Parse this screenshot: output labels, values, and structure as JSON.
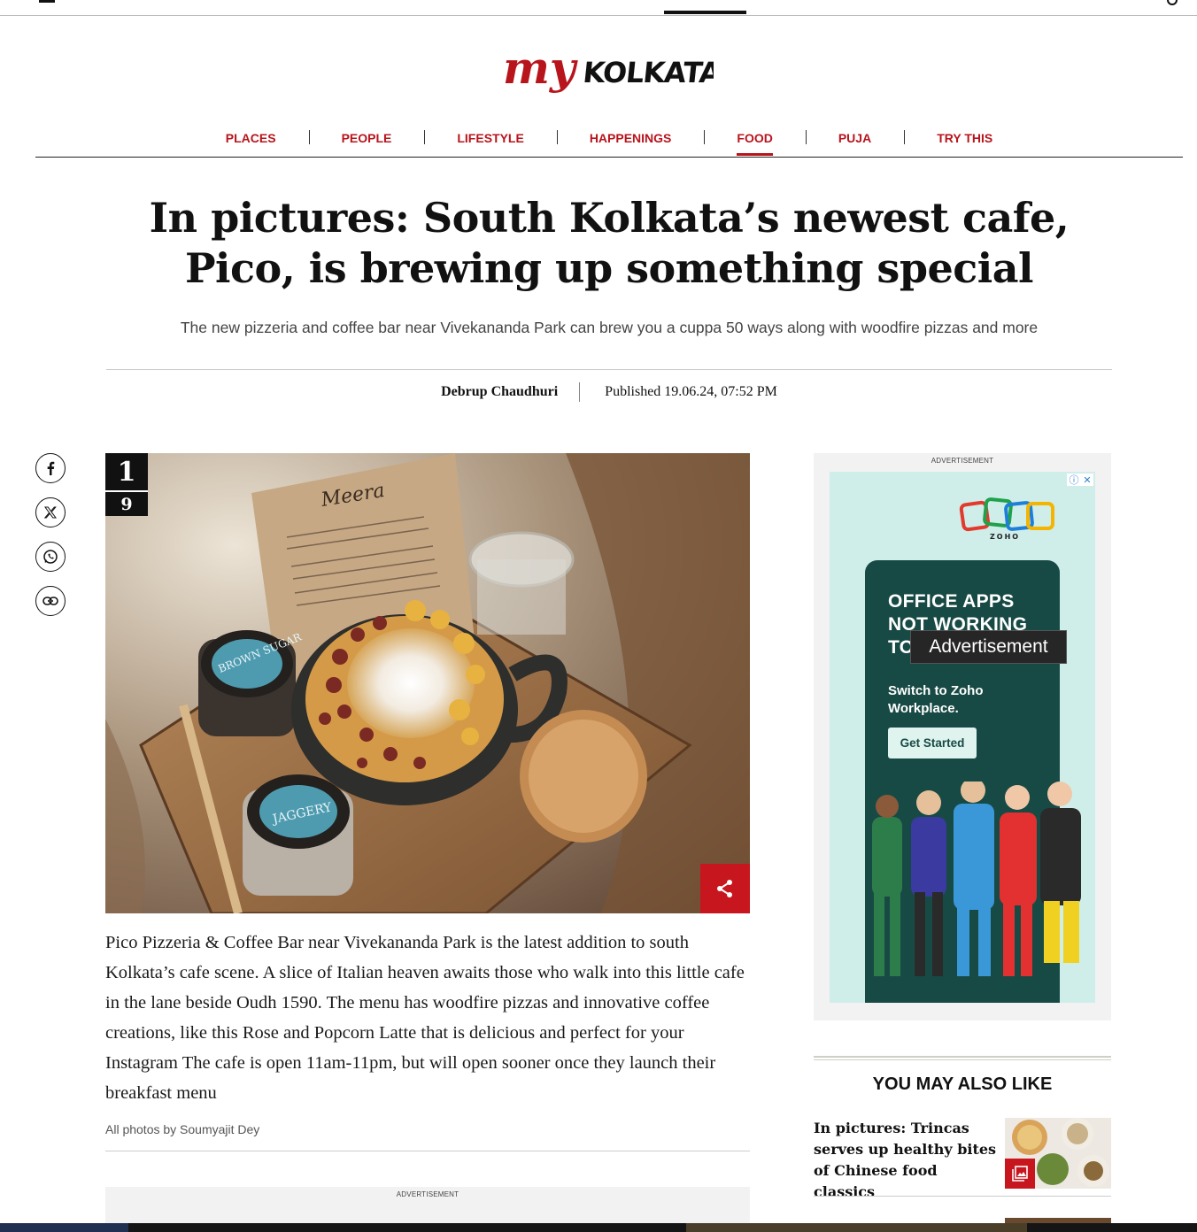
{
  "site": {
    "logo_text_my": "my",
    "logo_text_city": "KOLKATA"
  },
  "nav": {
    "items": [
      {
        "label": "PLACES"
      },
      {
        "label": "PEOPLE"
      },
      {
        "label": "LIFESTYLE"
      },
      {
        "label": "HAPPENINGS"
      },
      {
        "label": "FOOD",
        "active": true
      },
      {
        "label": "PUJA"
      },
      {
        "label": "TRY THIS"
      }
    ]
  },
  "article": {
    "title": "In pictures: South Kolkata’s newest cafe, Pico, is brewing up something special",
    "subtitle": "The new pizzeria and coffee bar near Vivekananda Park can brew you a cuppa 50 ways along with woodfire pizzas and more",
    "author": "Debrup Chaudhuri",
    "published": "Published 19.06.24, 07:52 PM",
    "gallery": {
      "current": "1",
      "total": "9",
      "caption": "Pico Pizzeria & Coffee Bar near Vivekananda Park is the latest addition to south Kolkata’s cafe scene. A slice of Italian heaven awaits those who walk into this little cafe in the lane beside Oudh 1590. The menu has woodfire pizzas and innovative coffee creations, like this Rose and Popcorn Latte that is delicious and perfect for your Instagram The cafe is open 11am-11pm, but will open sooner once they launch their breakfast menu",
      "credit": "All photos by Soumyajit Dey",
      "photo_text": {
        "menu_card": "Meera",
        "jar_1": "BROWN SUGAR",
        "jar_2": "JAGGERY"
      }
    }
  },
  "share": {
    "icons": [
      "facebook-icon",
      "x-icon",
      "whatsapp-icon",
      "link-icon"
    ]
  },
  "ads": {
    "label": "ADVERTISEMENT",
    "side": {
      "brand": "ZOHO",
      "headline": "OFFICE APPS NOT WORKING TO",
      "subline": "Switch to Zoho Workplace.",
      "cta": "Get Started",
      "tooltip": "Advertisement"
    },
    "bottom_label": "ADVERTISEMENT"
  },
  "related": {
    "heading": "YOU MAY ALSO LIKE",
    "items": [
      {
        "title": "In pictures: Trincas serves up healthy bites of Chinese food classics"
      }
    ]
  },
  "colors": {
    "brand_red": "#b8141c",
    "ad_dark_green": "#184a45",
    "ad_mint": "#cfeeea"
  }
}
